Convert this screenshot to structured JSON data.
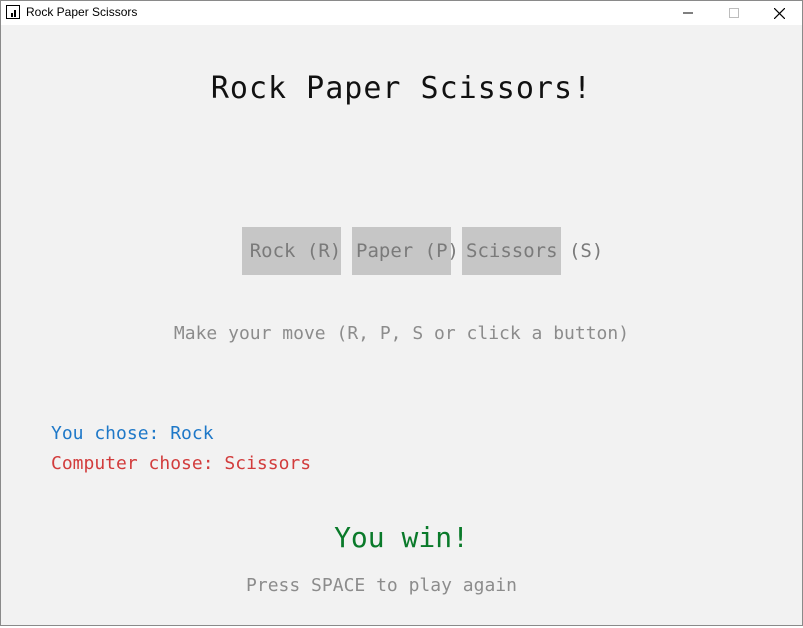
{
  "window": {
    "title": "Rock Paper Scissors",
    "icons": {
      "app": "app-icon",
      "minimize": "minimize-icon",
      "maximize": "maximize-icon",
      "close": "close-icon"
    }
  },
  "game": {
    "heading": "Rock Paper Scissors!",
    "buttons": {
      "rock": "Rock (R)",
      "paper": "Paper (P)",
      "scissors": "Scissors (S)"
    },
    "instruction": "Make your move (R, P, S or click a button)",
    "player_choice": "You chose: Rock",
    "computer_choice": "Computer chose: Scissors",
    "outcome": "You win!",
    "play_again": "Press SPACE to play again"
  },
  "colors": {
    "player": "#1e78c8",
    "computer": "#d23c3c",
    "win": "#0a7a2a",
    "button_bg": "#c6c6c6",
    "muted_text": "#8c8c8c"
  }
}
